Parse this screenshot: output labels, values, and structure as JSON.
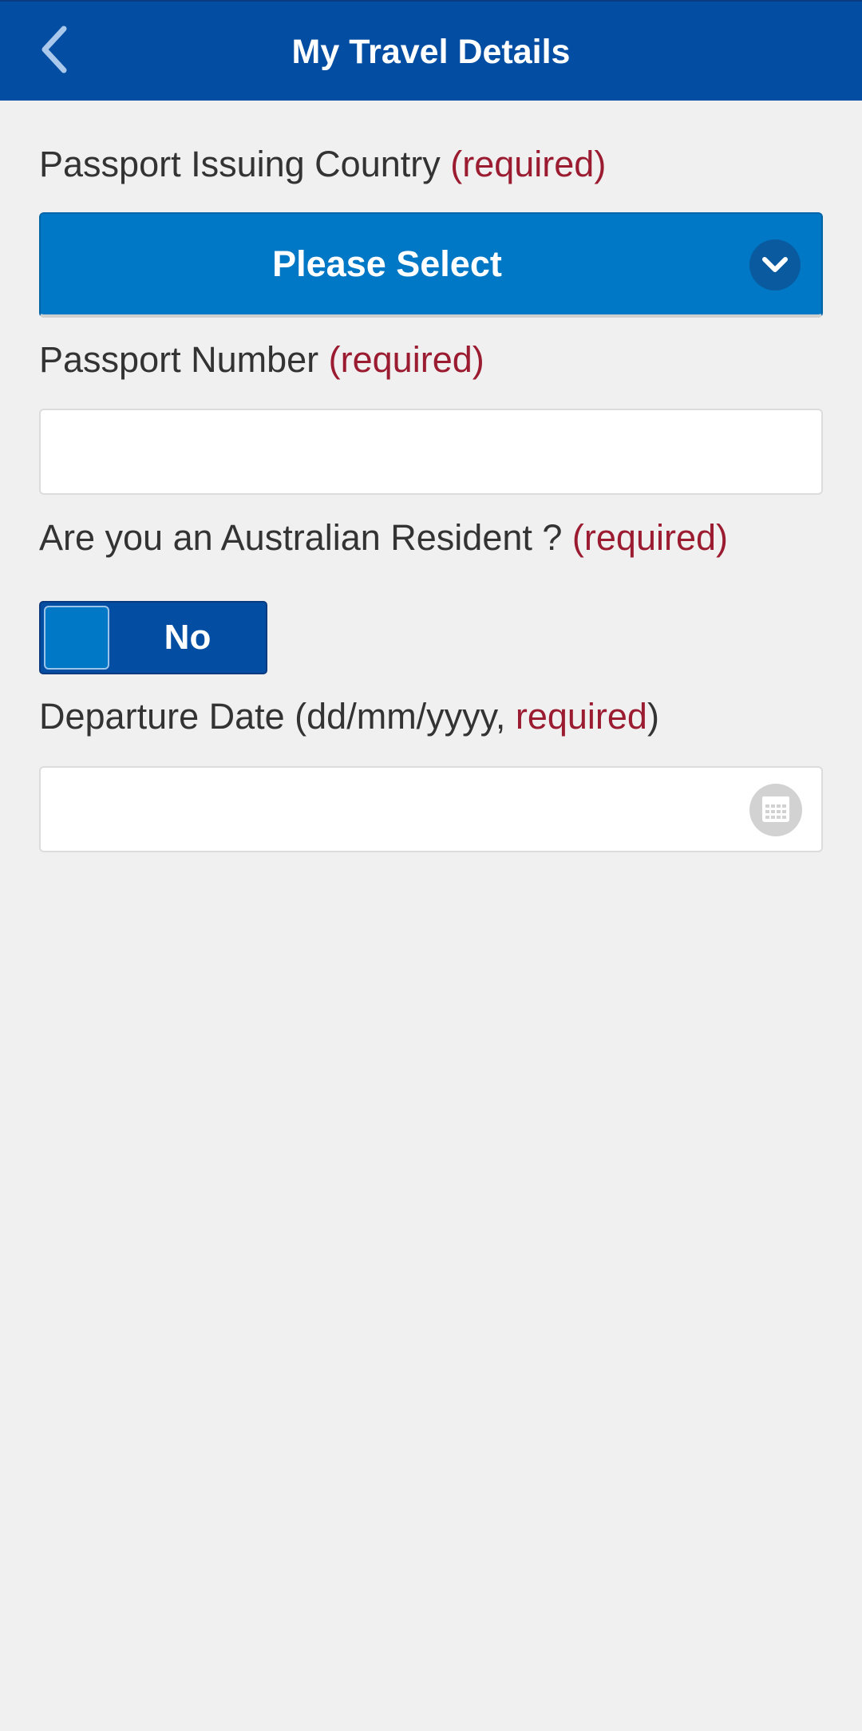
{
  "header": {
    "title": "My Travel Details",
    "back_icon": "chevron-left-icon",
    "color": "#034ea2"
  },
  "form": {
    "passport_country": {
      "label": "Passport Issuing Country",
      "required": "(required)",
      "select_value": "Please Select",
      "dropdown_icon": "chevron-down-icon",
      "color": "#0078c5"
    },
    "passport_number": {
      "label": "Passport Number",
      "required": "(required)",
      "value": ""
    },
    "australian_resident": {
      "label": "Are you an Australian Resident ?",
      "required": "(required)",
      "toggle_value": "No"
    },
    "departure_date": {
      "label_prefix": "Departure Date (dd/mm/yyyy, ",
      "required": "required",
      "label_suffix": ")",
      "value": "",
      "calendar_icon": "calendar-icon"
    }
  },
  "colors": {
    "required": "#9b1c31",
    "background": "#f0f0f0"
  }
}
